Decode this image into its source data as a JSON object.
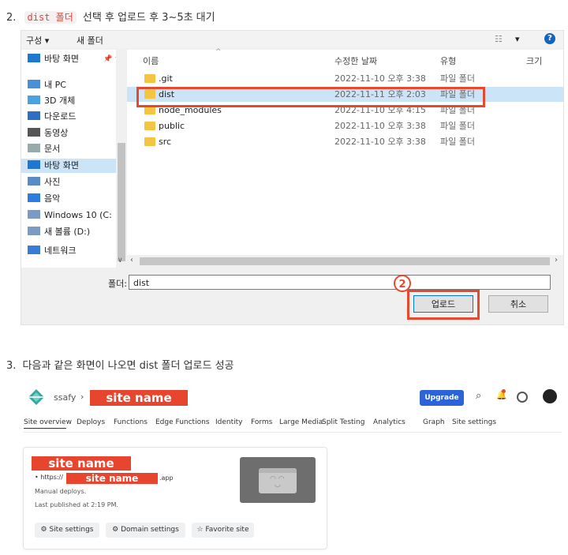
{
  "step2": {
    "number": "2.",
    "code": "dist 폴더",
    "text": "선택 후 업로드 후 3~5초 대기"
  },
  "dialog": {
    "toolbar": {
      "organize": "구성 ▾",
      "new_folder": "새 폴더",
      "view": "▾",
      "help": "?"
    },
    "nav": [
      {
        "label": "바탕 화면",
        "pin": "📌 ^",
        "selected": false,
        "icon": "desktop-icon"
      },
      {
        "label": "내 PC",
        "selected": false,
        "icon": "pc-icon"
      },
      {
        "label": "3D 개체",
        "selected": false,
        "icon": "cube-icon"
      },
      {
        "label": "다운로드",
        "selected": false,
        "icon": "download-icon"
      },
      {
        "label": "동영상",
        "selected": false,
        "icon": "video-icon"
      },
      {
        "label": "문서",
        "selected": false,
        "icon": "document-icon"
      },
      {
        "label": "바탕 화면",
        "selected": true,
        "icon": "desktop-icon"
      },
      {
        "label": "사진",
        "selected": false,
        "icon": "picture-icon"
      },
      {
        "label": "음악",
        "selected": false,
        "icon": "music-icon"
      },
      {
        "label": "Windows 10 (C:",
        "selected": false,
        "icon": "drive-icon"
      },
      {
        "label": "새 볼륨 (D:)",
        "selected": false,
        "icon": "drive-icon"
      },
      {
        "label": "네트워크",
        "selected": false,
        "icon": "network-icon"
      }
    ],
    "columns": {
      "name": "이름",
      "date": "수정한 날짜",
      "type": "유형",
      "size": "크기"
    },
    "files": [
      {
        "name": ".git",
        "date": "2022-11-10 오후 3:38",
        "type": "파일 폴더",
        "selected": false
      },
      {
        "name": "dist",
        "date": "2022-11-11 오후 2:03",
        "type": "파일 폴더",
        "selected": true
      },
      {
        "name": "node_modules",
        "date": "2022-11-10 오후 4:15",
        "type": "파일 폴더",
        "selected": false
      },
      {
        "name": "public",
        "date": "2022-11-10 오후 3:38",
        "type": "파일 폴더",
        "selected": false
      },
      {
        "name": "src",
        "date": "2022-11-10 오후 3:38",
        "type": "파일 폴더",
        "selected": false
      }
    ],
    "folder_label": "폴더:",
    "folder_value": "dist",
    "upload_label": "업로드",
    "cancel_label": "취소",
    "badge": "2"
  },
  "step3": {
    "number": "3.",
    "text": "다음과 같은 화면이 나오면 dist 폴더 업로드 성공"
  },
  "netlify": {
    "team": "ssafy",
    "sep": "›",
    "site_name": "site name",
    "upgrade": "Upgrade",
    "tabs": [
      "Site overview",
      "Deploys",
      "Functions",
      "Edge Functions",
      "Identity",
      "Forms",
      "Large Media",
      "Split Testing",
      "Analytics",
      "Graph",
      "Site settings"
    ],
    "card": {
      "title": "site name",
      "url_prefix": "https://",
      "url_name": "site name",
      "url_suffix": ".app",
      "deploy_type": "Manual deploys.",
      "published": "Last published at 2:19 PM.",
      "buttons": [
        "Site settings",
        "Domain settings",
        "Favorite site"
      ]
    }
  },
  "colors": {
    "accent_red": "#e64a2e",
    "netlify_blue": "#2c63d8",
    "selection": "#cce4f7"
  }
}
